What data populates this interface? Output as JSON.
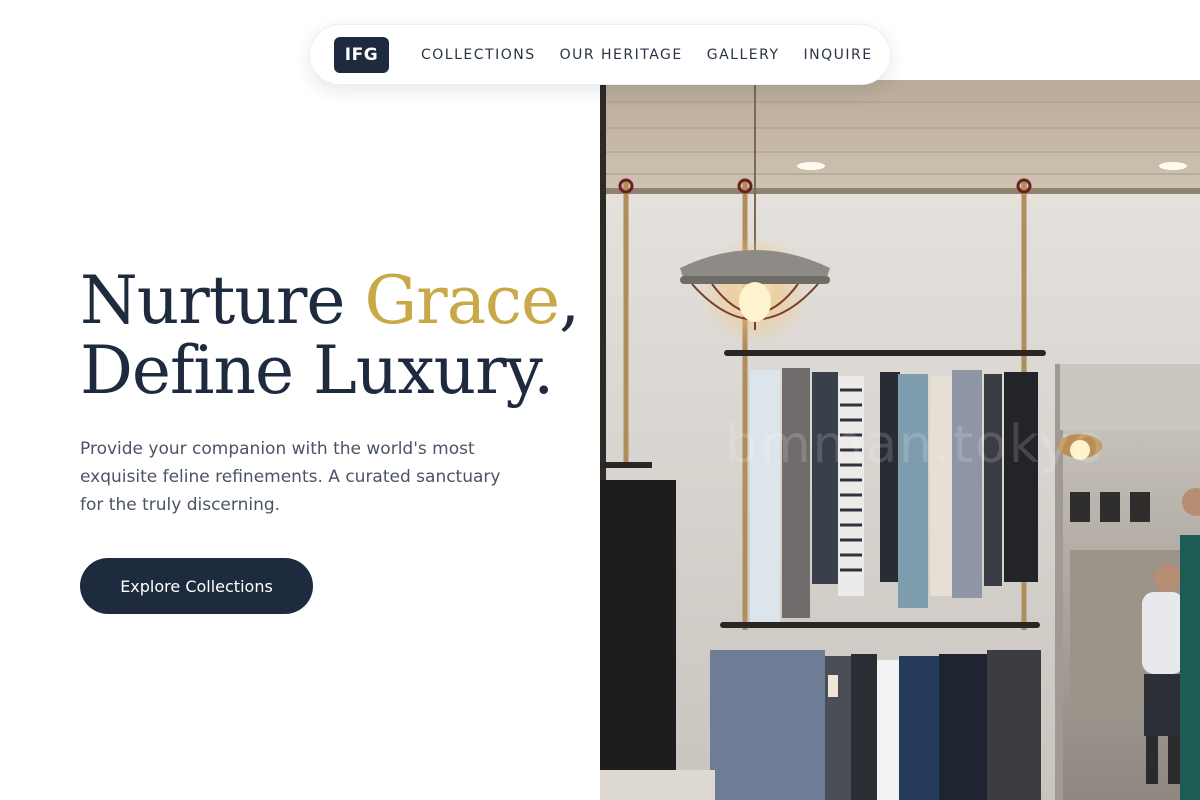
{
  "brand": {
    "logo_text": "IFG"
  },
  "nav": {
    "items": [
      {
        "label": "COLLECTIONS"
      },
      {
        "label": "OUR HERITAGE"
      },
      {
        "label": "GALLERY"
      },
      {
        "label": "INQUIRE"
      }
    ]
  },
  "hero": {
    "title_line1_pre": "Nurture ",
    "title_line1_accent": "Grace",
    "title_line1_post": ",",
    "title_line2": "Define Luxury.",
    "subtitle": "Provide your companion with the world's most exquisite feline refinements. A curated sanctuary for the truly discerning.",
    "cta_label": "Explore Collections",
    "image_watermark": "bmman.tokyo"
  },
  "colors": {
    "navy": "#1e2a3d",
    "gold_accent": "#c9a947",
    "body_text": "#4a5466",
    "background": "#ffffff"
  }
}
